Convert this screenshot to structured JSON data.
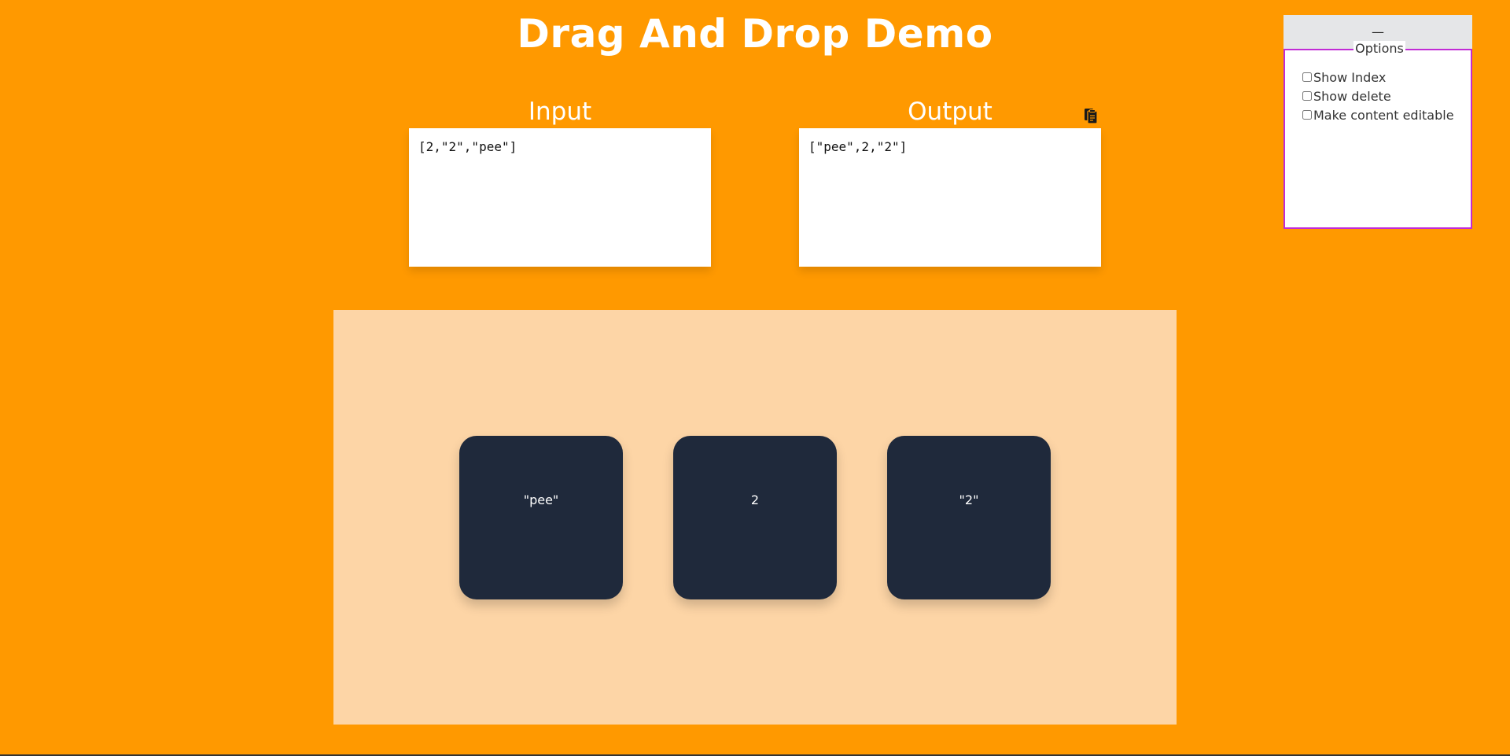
{
  "header": {
    "title": "Drag And Drop Demo"
  },
  "input_panel": {
    "label": "Input",
    "value": "[2,\"2\",\"pee\"]"
  },
  "output_panel": {
    "label": "Output",
    "value": "[\"pee\",2,\"2\"]",
    "copy_icon": "clipboard-icon"
  },
  "options": {
    "collapse_label": "—",
    "legend": "Options",
    "items": [
      {
        "label": "Show Index",
        "checked": false
      },
      {
        "label": "Show delete",
        "checked": false
      },
      {
        "label": "Make content editable",
        "checked": false
      }
    ]
  },
  "board": {
    "cards": [
      {
        "text": "\"pee\""
      },
      {
        "text": "2"
      },
      {
        "text": "\"2\""
      }
    ]
  },
  "colors": {
    "background": "#FF9900",
    "board": "#FDD5A6",
    "card": "#1F293B",
    "options_border": "#C12BD6"
  }
}
